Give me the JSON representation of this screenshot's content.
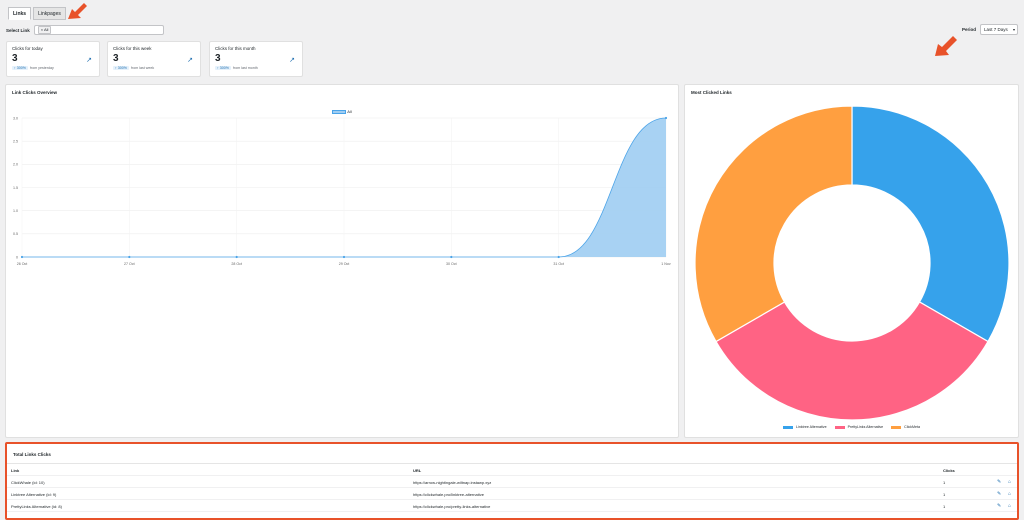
{
  "tabs": [
    {
      "label": "Links"
    },
    {
      "label": "Linkpages"
    }
  ],
  "select_link": {
    "label": "Select Link",
    "chip": "× All"
  },
  "period": {
    "label": "Period",
    "value": "Last 7 Days"
  },
  "stats": [
    {
      "title": "Clicks for today",
      "value": "3",
      "pct": "↑ 300%",
      "note": "from yesterday"
    },
    {
      "title": "Clicks for this week",
      "value": "3",
      "pct": "↑ 300%",
      "note": "from last week"
    },
    {
      "title": "Clicks for this month",
      "value": "3",
      "pct": "↑ 300%",
      "note": "from last month"
    }
  ],
  "overview": {
    "title": "Link Clicks Overview",
    "legend": "All"
  },
  "chart_data": [
    {
      "type": "area",
      "x": [
        "26 Oct",
        "27 Oct",
        "28 Oct",
        "29 Oct",
        "30 Oct",
        "31 Oct",
        "1 Nov"
      ],
      "series": [
        {
          "name": "All",
          "values": [
            0,
            0,
            0,
            0,
            0,
            0,
            3
          ]
        }
      ],
      "ylim": [
        0,
        3
      ],
      "yticks": [
        "0",
        "0.5",
        "1.0",
        "1.5",
        "2.0",
        "2.5",
        "3.0"
      ],
      "grid": true,
      "legend": "top-center",
      "colors": {
        "fill": "#9fcdf2",
        "line": "#4aa3e8"
      }
    },
    {
      "type": "pie",
      "title": "Most Clicked Links",
      "labels": [
        "Linktree Alternative",
        "PrettyLinks Alternative",
        "ClickMeta"
      ],
      "values": [
        1,
        1,
        1
      ],
      "colors": [
        "#36a2eb",
        "#ff6384",
        "#ff9f40"
      ],
      "legend": "bottom"
    }
  ],
  "most_clicked": {
    "title": "Most Clicked Links"
  },
  "table": {
    "title": "Total Links Clicks",
    "headers": {
      "link": "Link",
      "url": "URL",
      "clicks": "Clicks"
    },
    "rows": [
      {
        "link": "ClickWhale (id: 10)",
        "url": "https://arrow-nightingale-wiltnap.instawp.xyz",
        "clicks": "1"
      },
      {
        "link": "Linktree Alternative (id: 9)",
        "url": "https://clickwhale.pro/linktree-alternative",
        "clicks": "1"
      },
      {
        "link": "PrettyLinks Alternative (id: 8)",
        "url": "https://clickwhale.pro/pretty-links-alternative",
        "clicks": "1"
      }
    ]
  },
  "colors": {
    "accent": "#2271b1",
    "annotation": "#e8522a"
  }
}
